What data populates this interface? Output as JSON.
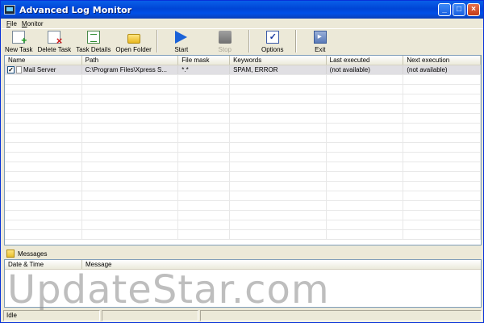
{
  "window": {
    "title": "Advanced Log Monitor"
  },
  "menu": [
    "File",
    "Monitor"
  ],
  "toolbar": {
    "new_task": "New Task",
    "delete_task": "Delete Task",
    "task_details": "Task Details",
    "open_folder": "Open Folder",
    "start": "Start",
    "stop": "Stop",
    "options": "Options",
    "exit": "Exit"
  },
  "tasks": {
    "columns": [
      "Name",
      "Path",
      "File mask",
      "Keywords",
      "Last executed",
      "Next execution"
    ],
    "rows": [
      {
        "checked": true,
        "name": "Mail Server",
        "path": "C:\\Program Files\\Xpress S...",
        "file_mask": "*.*",
        "keywords": "SPAM, ERROR",
        "last_executed": "(not available)",
        "next_execution": "(not available)"
      }
    ]
  },
  "messages": {
    "label": "Messages",
    "columns": [
      "Date & Time",
      "Message"
    ]
  },
  "watermark": "UpdateStar.com",
  "status": {
    "text": "Idle"
  }
}
